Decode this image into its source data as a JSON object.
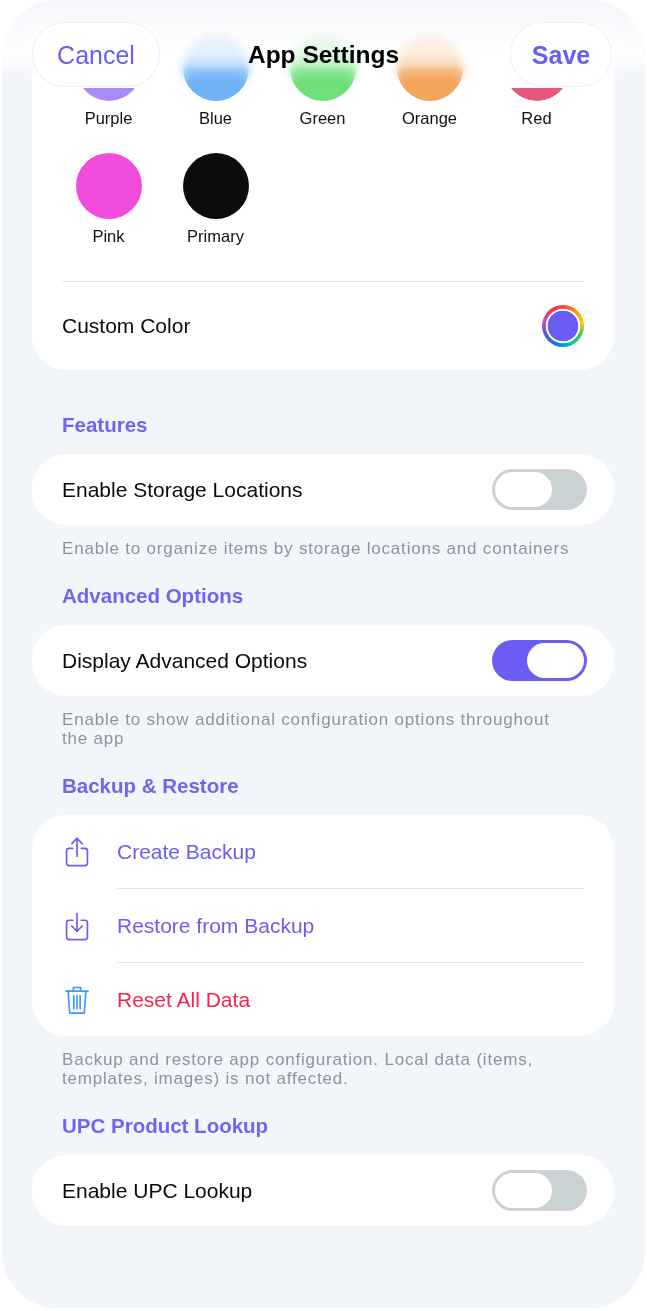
{
  "nav": {
    "cancel": "Cancel",
    "title": "App Settings",
    "save": "Save"
  },
  "colors": {
    "swatches": [
      {
        "label": "Purple",
        "color": "#a98af7"
      },
      {
        "label": "Blue",
        "color": "#6fb3f6"
      },
      {
        "label": "Green",
        "color": "#6fe07a"
      },
      {
        "label": "Orange",
        "color": "#f2a55c"
      },
      {
        "label": "Red",
        "color": "#e5577a"
      },
      {
        "label": "Pink",
        "color": "#f24cdc"
      },
      {
        "label": "Primary",
        "color": "#0b0c0c"
      }
    ],
    "custom": {
      "label": "Custom Color",
      "color": "#6a5cf4"
    }
  },
  "sections": [
    {
      "title": "Features",
      "rows": [
        {
          "kind": "toggle",
          "label": "Enable Storage Locations",
          "on": false
        }
      ],
      "footer": "Enable to organize items by storage locations and containers"
    },
    {
      "title": "Advanced Options",
      "rows": [
        {
          "kind": "toggle",
          "label": "Display Advanced Options",
          "on": true
        }
      ],
      "footer": "Enable to show additional configuration options throughout the app"
    },
    {
      "title": "Backup & Restore",
      "rows": [
        {
          "kind": "export",
          "label": "Create Backup"
        },
        {
          "kind": "import",
          "label": "Restore from Backup"
        },
        {
          "kind": "reset",
          "label": "Reset All Data"
        }
      ],
      "footer": "Backup and restore app configuration. Local data (items, templates, images) is not affected."
    },
    {
      "title": "UPC Product Lookup",
      "rows": [
        {
          "kind": "toggle",
          "label": "Enable UPC Lookup",
          "on": false
        }
      ]
    }
  ]
}
